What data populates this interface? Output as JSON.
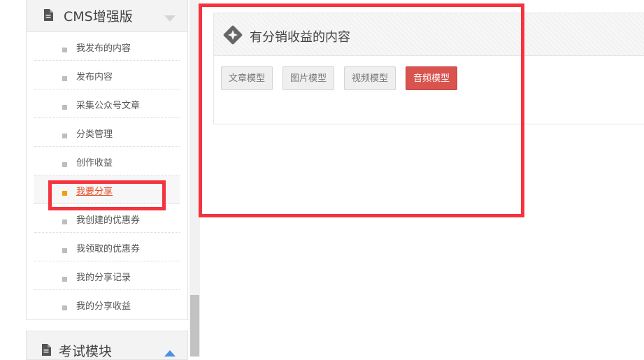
{
  "sidebar": {
    "section_title": "CMS增强版",
    "items": [
      {
        "label": "我发布的内容"
      },
      {
        "label": "发布内容"
      },
      {
        "label": "采集公众号文章"
      },
      {
        "label": "分类管理"
      },
      {
        "label": "创作收益"
      },
      {
        "label": "我要分享",
        "active": true
      },
      {
        "label": "我创建的优惠券"
      },
      {
        "label": "我领取的优惠券"
      },
      {
        "label": "我的分享记录"
      },
      {
        "label": "我的分享收益"
      }
    ],
    "next_section_title": "考试模块"
  },
  "content": {
    "title": "有分销收益的内容",
    "buttons": [
      {
        "label": "文章模型"
      },
      {
        "label": "图片模型"
      },
      {
        "label": "视频模型"
      },
      {
        "label": "音频模型",
        "active": true
      }
    ]
  },
  "colors": {
    "active_accent": "#e8491d",
    "active_bullet": "#f39c12",
    "primary_button": "#d9534f",
    "highlight": "#f5333f"
  },
  "icons": {
    "section": "document-icon",
    "collapse": "chevron-down-icon",
    "expand": "chevron-up-icon",
    "content": "diamond-icon"
  }
}
